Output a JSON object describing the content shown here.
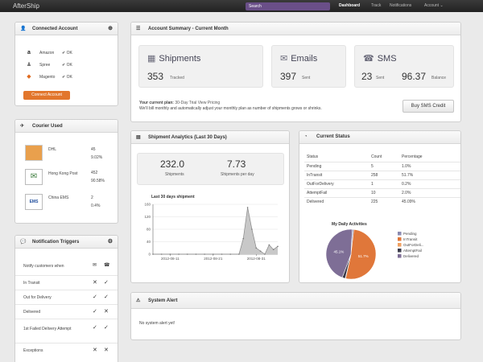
{
  "topbar": {
    "brand": "AfterShip",
    "search_placeholder": "Search",
    "nav": [
      "Dashboard",
      "Track",
      "Notifications",
      "Account ⌄"
    ]
  },
  "connected_account": {
    "title": "Connected Account",
    "items": [
      {
        "name": "Amazon",
        "status": "✔ OK"
      },
      {
        "name": "Spree",
        "status": "✔ OK"
      },
      {
        "name": "Magento",
        "status": "✔ OK"
      }
    ],
    "button": "Connect Account"
  },
  "courier_used": {
    "title": "Courier Used",
    "items": [
      {
        "name": "DHL",
        "count": "45",
        "percent": "9.02%",
        "logo_color": "#e9a04d"
      },
      {
        "name": "Hong Kong Post",
        "count": "452",
        "percent": "90.58%",
        "logo_color": "#ffffff"
      },
      {
        "name": "China EMS",
        "count": "2",
        "percent": "0.4%",
        "logo_color": "#ffffff"
      }
    ]
  },
  "notification_triggers": {
    "title": "Notification Triggers",
    "header": "Notify customers when",
    "rows": [
      {
        "label": "In Transit",
        "email": "✕",
        "sms": "✓"
      },
      {
        "label": "Out for Delivery",
        "email": "✓",
        "sms": "✓"
      },
      {
        "label": "Delivered",
        "email": "✓",
        "sms": "✕"
      },
      {
        "label": "1st Failed Delivery Attempt",
        "email": "✓",
        "sms": "✓"
      },
      {
        "label": "Exceptions",
        "email": "✕",
        "sms": "✕"
      }
    ]
  },
  "account_summary": {
    "title": "Account Summary - Current Month",
    "shipments": {
      "label": "Shipments",
      "value": "353",
      "sub": "Tracked"
    },
    "emails": {
      "label": "Emails",
      "value": "397",
      "sub": "Sent"
    },
    "sms": {
      "label": "SMS",
      "value": "23",
      "sub": "Sent",
      "balance": "96.37",
      "balance_label": "Balance"
    },
    "plan_label": "Your current plan:",
    "plan_name": "30-Day Trial View Pricing",
    "plan_note": "We'll bill monthly and automatically adjust your monthly plan as number of shipments grows or shrinks.",
    "button": "Buy SMS Credit"
  },
  "shipment_analytics": {
    "title": "Shipment Analytics (Last 30 Days)",
    "shipments_value": "232.0",
    "shipments_label": "Shipments",
    "per_day_value": "7.73",
    "per_day_label": "Shipments per day"
  },
  "current_status": {
    "title": "Current Status",
    "columns": [
      "Status",
      "Count",
      "Percentage"
    ],
    "rows": [
      [
        "Pending",
        "5",
        "1.0%"
      ],
      [
        "InTransit",
        "258",
        "51.7%"
      ],
      [
        "OutForDelivery",
        "1",
        "0.2%"
      ],
      [
        "AttemptFail",
        "10",
        "2.0%"
      ],
      [
        "Delivered",
        "225",
        "45.09%"
      ]
    ]
  },
  "system_alert": {
    "title": "System Alert",
    "message": "No system alert yet!"
  },
  "chart_data": [
    {
      "type": "area",
      "title": "Last 30 days shipment",
      "x": [
        "2012-08-07",
        "2012-08-09",
        "2012-08-11",
        "2012-08-13",
        "2012-08-15",
        "2012-08-17",
        "2012-08-19",
        "2012-08-21",
        "2012-08-23",
        "2012-08-25",
        "2012-08-27",
        "2012-08-28",
        "2012-08-29",
        "2012-08-30",
        "2012-08-31",
        "2012-09-01",
        "2012-09-02",
        "2012-09-03",
        "2012-09-04",
        "2012-09-05"
      ],
      "values": [
        0,
        0,
        0,
        0,
        0,
        0,
        0,
        0,
        0,
        0,
        0,
        50,
        150,
        80,
        20,
        10,
        0,
        30,
        15,
        25
      ],
      "xticks": [
        "2012-08-11",
        "2012-08-21",
        "2012-08-31"
      ],
      "yticks": [
        0,
        40,
        80,
        120,
        160
      ],
      "ylim": [
        0,
        160
      ],
      "color": "#9a9a9a"
    },
    {
      "type": "pie",
      "title": "My Daily Activities",
      "labels": [
        "Pending",
        "InTransit",
        "OutForDeli...",
        "AttemptFail",
        "Delivered"
      ],
      "values": [
        1.0,
        51.7,
        0.2,
        2.0,
        45.09
      ],
      "colors": [
        "#8a8ab0",
        "#e0773a",
        "#f0a060",
        "#3a3a4a",
        "#7e6e96"
      ],
      "slice_labels": [
        "51.7%",
        "45.1%"
      ]
    }
  ]
}
